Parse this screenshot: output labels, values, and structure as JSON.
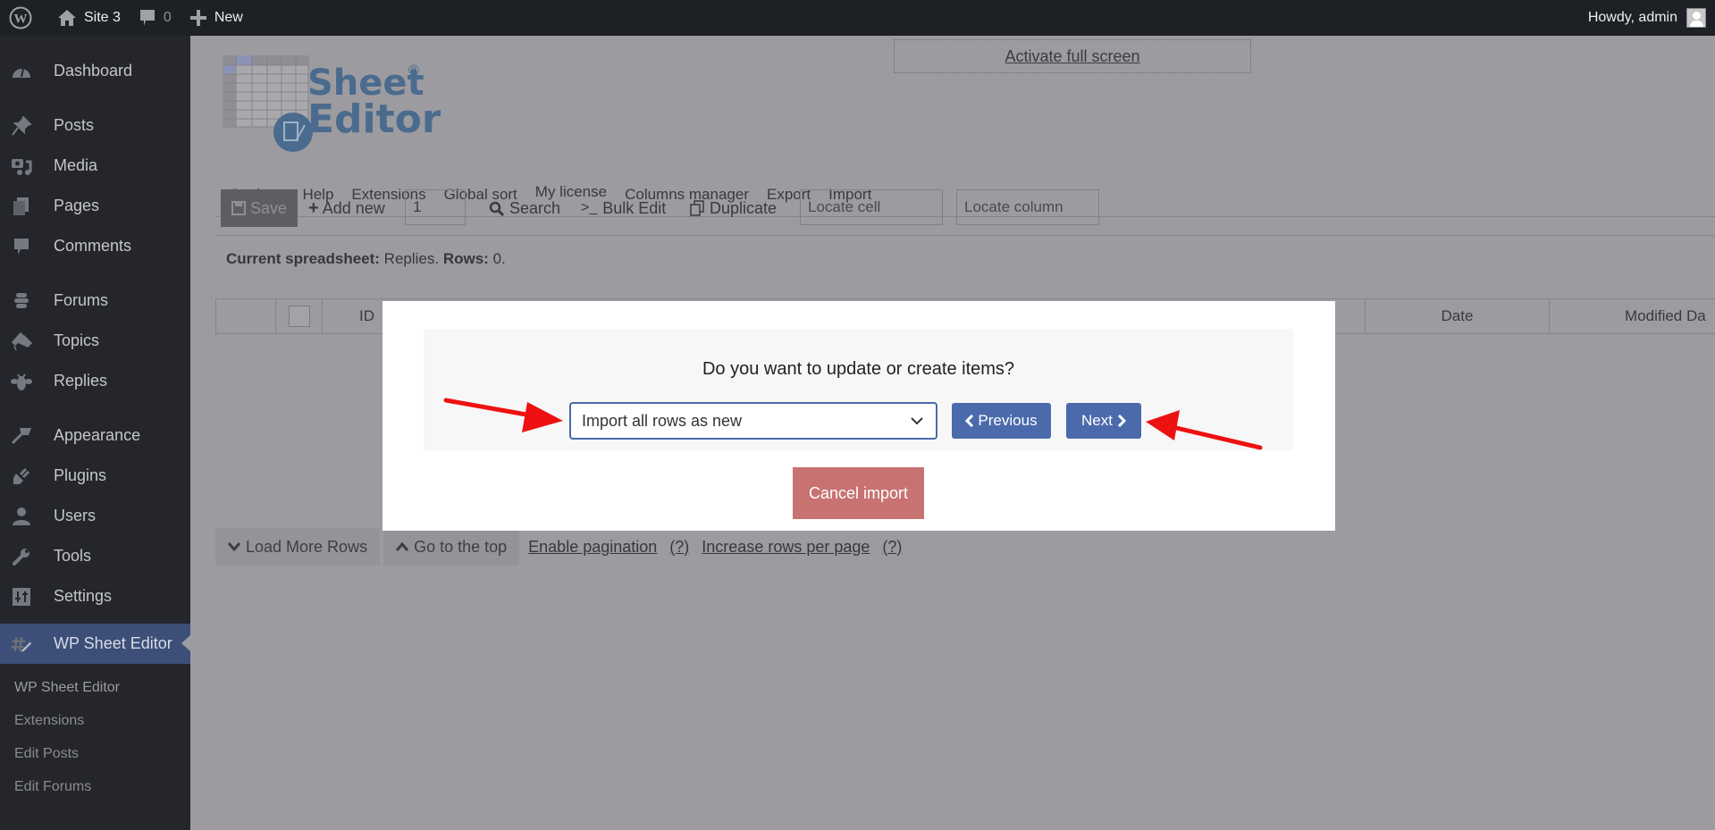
{
  "adminbar": {
    "site_name": "Site 3",
    "comment_count": "0",
    "new_label": "New",
    "howdy": "Howdy, admin",
    "icons": [
      "wordpress-logo-icon",
      "home-icon",
      "comment-bubble-icon",
      "plus-icon",
      "avatar"
    ]
  },
  "sidebar": {
    "items": [
      {
        "label": "Dashboard",
        "icon": "dashboard-icon"
      },
      {
        "label": "Posts",
        "icon": "pushpin-icon"
      },
      {
        "label": "Media",
        "icon": "media-icon"
      },
      {
        "label": "Pages",
        "icon": "pages-icon"
      },
      {
        "label": "Comments",
        "icon": "comment-icon"
      },
      {
        "label": "Forums",
        "icon": "forums-icon"
      },
      {
        "label": "Topics",
        "icon": "topics-icon"
      },
      {
        "label": "Replies",
        "icon": "replies-icon"
      },
      {
        "label": "Appearance",
        "icon": "paintbrush-icon"
      },
      {
        "label": "Plugins",
        "icon": "plug-icon"
      },
      {
        "label": "Users",
        "icon": "user-icon"
      },
      {
        "label": "Tools",
        "icon": "wrench-icon"
      },
      {
        "label": "Settings",
        "icon": "settings-sliders-icon"
      }
    ],
    "active": {
      "label": "WP Sheet Editor",
      "icon": "hash-pencil-icon"
    },
    "submenu": [
      "WP Sheet Editor",
      "Extensions",
      "Edit Posts",
      "Edit Forums"
    ]
  },
  "main": {
    "fullscreen_link": "Activate full screen",
    "logo": {
      "line1": "Sheet",
      "line2": "Editor",
      "reg": "®"
    },
    "nav": [
      "Settings",
      "Help",
      "Extensions",
      "Global sort",
      "My license",
      "Columns manager",
      "Export",
      "Import"
    ],
    "toolbar": {
      "save": "Save",
      "add_new": "Add new",
      "add_new_count": "1",
      "search": "Search",
      "bulk_edit": "Bulk Edit",
      "duplicate": "Duplicate",
      "locate_cell_placeholder": "Locate cell",
      "locate_column_placeholder": "Locate column"
    },
    "current_sheet": {
      "label": "Current spreadsheet:",
      "value": "Replies.",
      "rows_label": "Rows:",
      "rows_value": "0."
    },
    "columns": [
      "ID",
      "Date",
      "Modified Da"
    ],
    "bottom": {
      "load_more": "Load More Rows",
      "go_top": "Go to the top",
      "enable_pagination": "Enable pagination",
      "help1": "(?)",
      "increase_rows": "Increase rows per page",
      "help2": "(?)"
    }
  },
  "modal": {
    "question": "Do you want to update or create items?",
    "select_value": "Import all rows as new",
    "previous": "Previous",
    "next": "Next",
    "cancel": "Cancel import"
  },
  "annotations": {
    "arrow_color": "#ee1111"
  }
}
